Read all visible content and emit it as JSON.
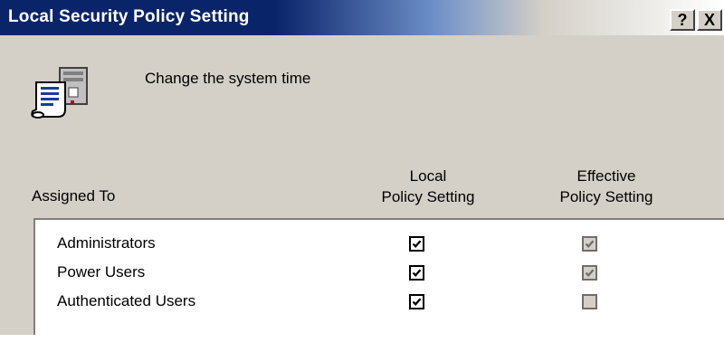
{
  "window": {
    "title": "Local Security Policy Setting",
    "help_button": "?",
    "close_button": "X"
  },
  "policy": {
    "icon": "security-policy-icon",
    "name": "Change the system time"
  },
  "columns": {
    "assigned_to": "Assigned To",
    "local_line1": "Local",
    "local_line2": "Policy Setting",
    "effective_line1": "Effective",
    "effective_line2": "Policy Setting"
  },
  "rows": [
    {
      "name": "Administrators",
      "local": true,
      "effective": true
    },
    {
      "name": "Power Users",
      "local": true,
      "effective": true
    },
    {
      "name": "Authenticated Users",
      "local": true,
      "effective": false
    }
  ],
  "colors": {
    "title_bar": "#0a246a",
    "window_bg": "#d4d0c8"
  }
}
